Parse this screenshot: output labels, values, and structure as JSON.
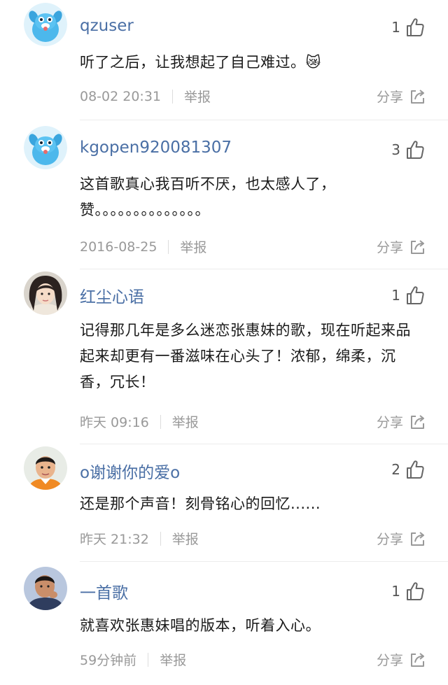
{
  "comments": [
    {
      "username": "qzuser",
      "likes": "1",
      "text": "听了之后，让我想起了自己难过。😿",
      "time": "08-02 20:31",
      "report": "举报",
      "share": "分享",
      "avatar": "blue-cartoon-mascot"
    },
    {
      "username": "kgopen920081307",
      "likes": "3",
      "text": "这首歌真心我百听不厌，也太感人了，赞。。。。。。。。。。。。。。",
      "time": "2016-08-25",
      "report": "举报",
      "share": "分享",
      "avatar": "blue-cartoon-mascot"
    },
    {
      "username": "红尘心语",
      "likes": "1",
      "text": "记得那几年是多么迷恋张惠妹的歌，现在听起来品起来却更有一番滋味在心头了！浓郁，绵柔，沉香，冗长！",
      "time": "昨天 09:16",
      "report": "举报",
      "share": "分享",
      "avatar": "girl-photo"
    },
    {
      "username": "o谢谢你的爱o",
      "likes": "2",
      "text": "还是那个声音！刻骨铭心的回忆......",
      "time": "昨天 21:32",
      "report": "举报",
      "share": "分享",
      "avatar": "child-photo"
    },
    {
      "username": "一首歌",
      "likes": "1",
      "text": "就喜欢张惠妹唱的版本，听着入心。",
      "time": "59分钟前",
      "report": "举报",
      "share": "分享",
      "avatar": "man-photo"
    }
  ],
  "colors": {
    "username": "#4a6fa5",
    "meta": "#999999",
    "text": "#1a1a1a"
  }
}
